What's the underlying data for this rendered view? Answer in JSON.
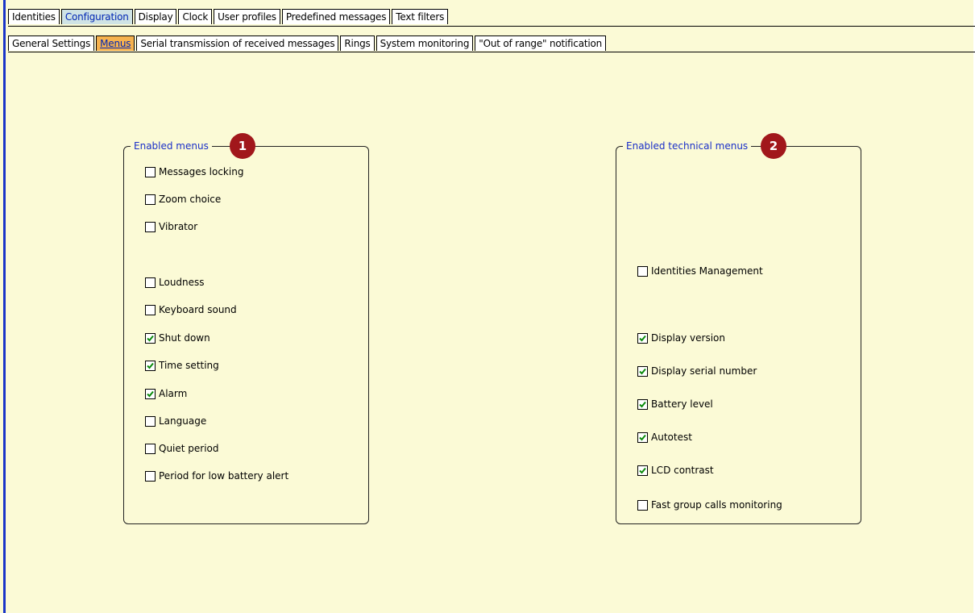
{
  "tabs": [
    {
      "label": "Identities",
      "active": false
    },
    {
      "label": "Configuration",
      "active": true
    },
    {
      "label": "Display",
      "active": false
    },
    {
      "label": "Clock",
      "active": false
    },
    {
      "label": "User profiles",
      "active": false
    },
    {
      "label": "Predefined messages",
      "active": false
    },
    {
      "label": "Text filters",
      "active": false
    }
  ],
  "subtabs": [
    {
      "label": "General Settings",
      "active": false
    },
    {
      "label": "Menus",
      "active": true
    },
    {
      "label": "Serial transmission of received messages",
      "active": false
    },
    {
      "label": "Rings",
      "active": false
    },
    {
      "label": "System monitoring",
      "active": false
    },
    {
      "label": "\"Out of range\" notification",
      "active": false
    }
  ],
  "enabled_menus": {
    "title": "Enabled menus",
    "badge": "1",
    "items": [
      {
        "label": "Messages locking",
        "checked": false
      },
      {
        "label": "Zoom choice",
        "checked": false
      },
      {
        "label": "Vibrator",
        "checked": false
      },
      {
        "label": "Loudness",
        "checked": false
      },
      {
        "label": "Keyboard sound",
        "checked": false
      },
      {
        "label": "Shut down",
        "checked": true
      },
      {
        "label": "Time setting",
        "checked": true
      },
      {
        "label": "Alarm",
        "checked": true
      },
      {
        "label": "Language",
        "checked": false
      },
      {
        "label": "Quiet period",
        "checked": false
      },
      {
        "label": "Period for low battery alert",
        "checked": false
      }
    ]
  },
  "enabled_technical_menus": {
    "title": "Enabled technical menus",
    "badge": "2",
    "items": [
      {
        "label": "Identities Management",
        "checked": false
      },
      {
        "label": "Display version",
        "checked": true
      },
      {
        "label": "Display serial number",
        "checked": true
      },
      {
        "label": "Battery level",
        "checked": true
      },
      {
        "label": "Autotest",
        "checked": true
      },
      {
        "label": "LCD contrast",
        "checked": true
      },
      {
        "label": "Fast group calls monitoring",
        "checked": false
      }
    ]
  },
  "colors": {
    "background": "#fbfad6",
    "group_title": "#1a2fc8",
    "badge": "#a1171b",
    "active_tab": "#cfe3e5",
    "active_subtab": "#f6b24f",
    "check": "#0a8a0a"
  }
}
